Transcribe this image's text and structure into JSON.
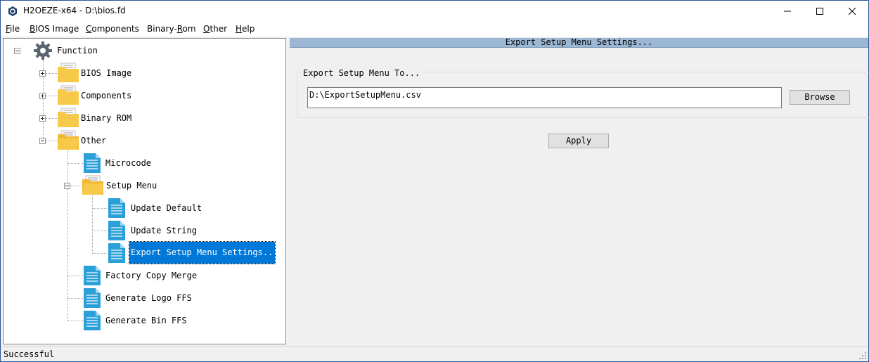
{
  "window": {
    "title": "H2OEZE-x64  -  D:\\bios.fd",
    "minimize_icon": "minimize-icon",
    "maximize_icon": "maximize-icon",
    "close_icon": "close-icon"
  },
  "menu": {
    "file": {
      "mnemonic": "F",
      "rest": "ile"
    },
    "bios_image": {
      "mnemonic": "B",
      "rest": "IOS Image"
    },
    "components": {
      "mnemonic": "C",
      "rest": "omponents"
    },
    "binary_rom": {
      "pre": "Binary-",
      "mnemonic": "R",
      "rest": "om"
    },
    "other": {
      "mnemonic": "O",
      "rest": "ther"
    },
    "help": {
      "mnemonic": "H",
      "rest": "elp"
    }
  },
  "tree": {
    "root": {
      "label": "Function",
      "icon": "gear-icon"
    },
    "items": {
      "bios_image": "BIOS Image",
      "components": "Components",
      "binary_rom": "Binary ROM",
      "other": "Other",
      "microcode": "Microcode",
      "setup_menu": "Setup Menu",
      "update_default": "Update Default",
      "update_string": "Update String",
      "export_setup_menu_settings": "Export Setup Menu Settings...",
      "factory_copy_merge": "Factory Copy Merge",
      "generate_logo_ffs": "Generate Logo FFS",
      "generate_bin_ffs": "Generate Bin FFS"
    },
    "selected": "Export Setup Menu Settings..."
  },
  "panel": {
    "header": "Export Setup Menu Settings...",
    "group_label": "Export Setup Menu To...",
    "path_value": "D:\\ExportSetupMenu.csv",
    "browse_label": "Browse",
    "apply_label": "Apply"
  },
  "status": {
    "text": "Successful"
  },
  "colors": {
    "selection": "#0078d7",
    "header_strip": "#9bb7d3",
    "folder": "#f7c948",
    "document": "#2a9fd8"
  }
}
